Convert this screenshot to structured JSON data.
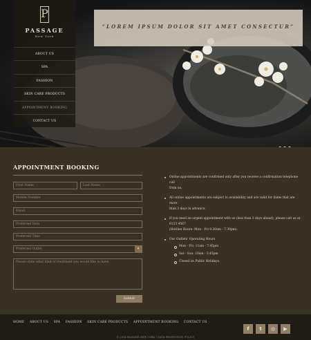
{
  "logo": {
    "mark": "P",
    "name": "PASSAGE",
    "sub": "New York"
  },
  "nav": [
    {
      "label": "ABOUT US"
    },
    {
      "label": "SPA"
    },
    {
      "label": "FASHION"
    },
    {
      "label": "SKIN CARE PRODUCTS"
    },
    {
      "label": "APPOINTMENT BOOKING",
      "active": true
    },
    {
      "label": "CONTACT US"
    }
  ],
  "hero": {
    "banner": "“LOREM IPSUM DOLOR SIT AMET CONSECTUR”",
    "slides": 3
  },
  "booking": {
    "title": "APPOINTMENT BOOKING",
    "first_name": "First Name",
    "last_name": "Last Name",
    "mobile": "Mobile Number",
    "email": "Email",
    "preferred_date": "Preferred Date",
    "preferred_time": "Preferred Time",
    "preferred_outlet": "Preferred Outlet",
    "outlet_arrow": "▾",
    "message": "Please state what kind of treatment you would like to have",
    "submit": "Submit"
  },
  "info": {
    "p1a": "Online appointments are confirmed only after you receive a confirmation telephone call",
    "p1b": "from us.",
    "p2a": "All online appointments are subject to availability and are valid for dates that are more",
    "p2b": "than 3 days in advance.",
    "p3a": "If you need an urgent appointment with us (less than 3 days ahead), please call us at",
    "p3b": "6123 4567",
    "p3c": "(Hotline Hours: Mon - Fri 9.30am - 7.30pm).",
    "p4": "Our Outlets' Operating Hours",
    "h1": "Mon - Fri: 11am - 7.45pm",
    "h2": "Sat - Sun: 10am - 3.45pm",
    "h3": "Closed on Public Holidays."
  },
  "footer": {
    "links": [
      "HOME",
      "ABOUT US",
      "SPA",
      "FASHION",
      "SKIN CARE PRODUCTS",
      "APPOINTMENT BOOKING",
      "CONTACT US"
    ],
    "socials": [
      {
        "icon": "facebook-icon",
        "glyph": "f"
      },
      {
        "icon": "twitter-icon",
        "glyph": "t"
      },
      {
        "icon": "instagram-icon",
        "glyph": "◎"
      },
      {
        "icon": "youtube-icon",
        "glyph": "▶"
      }
    ],
    "copyright": "© 2014 PASSAGE NEW YORK | DATA PROTECTION POLICY"
  }
}
